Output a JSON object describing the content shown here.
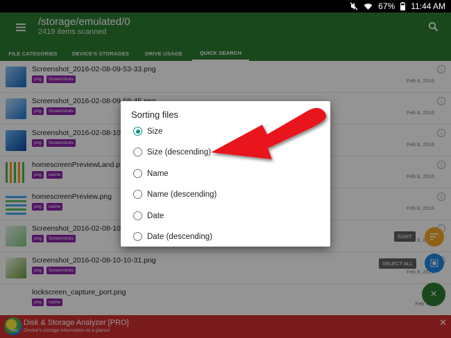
{
  "status_bar": {
    "battery": "67%",
    "time": "11:44 AM"
  },
  "header": {
    "path": "/storage/emulated/0",
    "items_scanned": "2419 items scanned",
    "tabs": [
      {
        "label": "FILE CATEGORIES"
      },
      {
        "label": "DEVICE'S STORAGES"
      },
      {
        "label": "DRIVE USAGE"
      },
      {
        "label": "QUICK SEARCH"
      }
    ]
  },
  "files": [
    {
      "name": "Screenshot_2016-02-08-09-53-33.png",
      "tags": [
        "png",
        "Screenshots"
      ],
      "date": "Feb 8, 2016"
    },
    {
      "name": "Screenshot_2016-02-08-09-59-45.png",
      "tags": [
        "png",
        "Screenshots"
      ],
      "date": "Feb 8, 2016"
    },
    {
      "name": "Screenshot_2016-02-08-10-0",
      "tags": [
        "png",
        "Screenshots"
      ],
      "date": "Feb 8, 2016"
    },
    {
      "name": "homescreenPreviewLand.png",
      "tags": [
        "png",
        "cache"
      ],
      "date": "Feb 8, 2016"
    },
    {
      "name": "homescreenPreview.png",
      "tags": [
        "png",
        "cache"
      ],
      "date": "Feb 8, 2016"
    },
    {
      "name": "Screenshot_2016-02-08-10-0",
      "tags": [
        "png",
        "Screenshots"
      ],
      "date": "Feb 8, 2016"
    },
    {
      "name": "Screenshot_2016-02-08-10-10-31.png",
      "tags": [
        "png",
        "Screenshots"
      ],
      "date": "Feb 8, 2016"
    },
    {
      "name": "lockscreen_capture_port.png",
      "tags": [
        "png",
        "cache"
      ],
      "date": "Feb 7, 2"
    }
  ],
  "fab": {
    "sort_label": "SORT",
    "select_all_label": "SELECT ALL",
    "close_glyph": "×"
  },
  "dialog": {
    "title": "Sorting files",
    "options": [
      {
        "label": "Size",
        "checked": true
      },
      {
        "label": "Size (descending)"
      },
      {
        "label": "Name"
      },
      {
        "label": "Name (descending)"
      },
      {
        "label": "Date"
      },
      {
        "label": "Date (descending)"
      }
    ]
  },
  "ad": {
    "title": "Disk & Storage Analyzer [PRO]",
    "subtitle": "Device's storage information at a glance",
    "close_glyph": "✕",
    "logo_text": "PRO"
  },
  "colors": {
    "appbar": "#2e7d32",
    "tag": "#8e24aa",
    "accent": "#009688",
    "ad": "#d32f2f",
    "arrow": "#e8151b",
    "fab_orange": "#f9a825",
    "fab_blue": "#1e88e5",
    "fab_green": "#2e7d32"
  }
}
